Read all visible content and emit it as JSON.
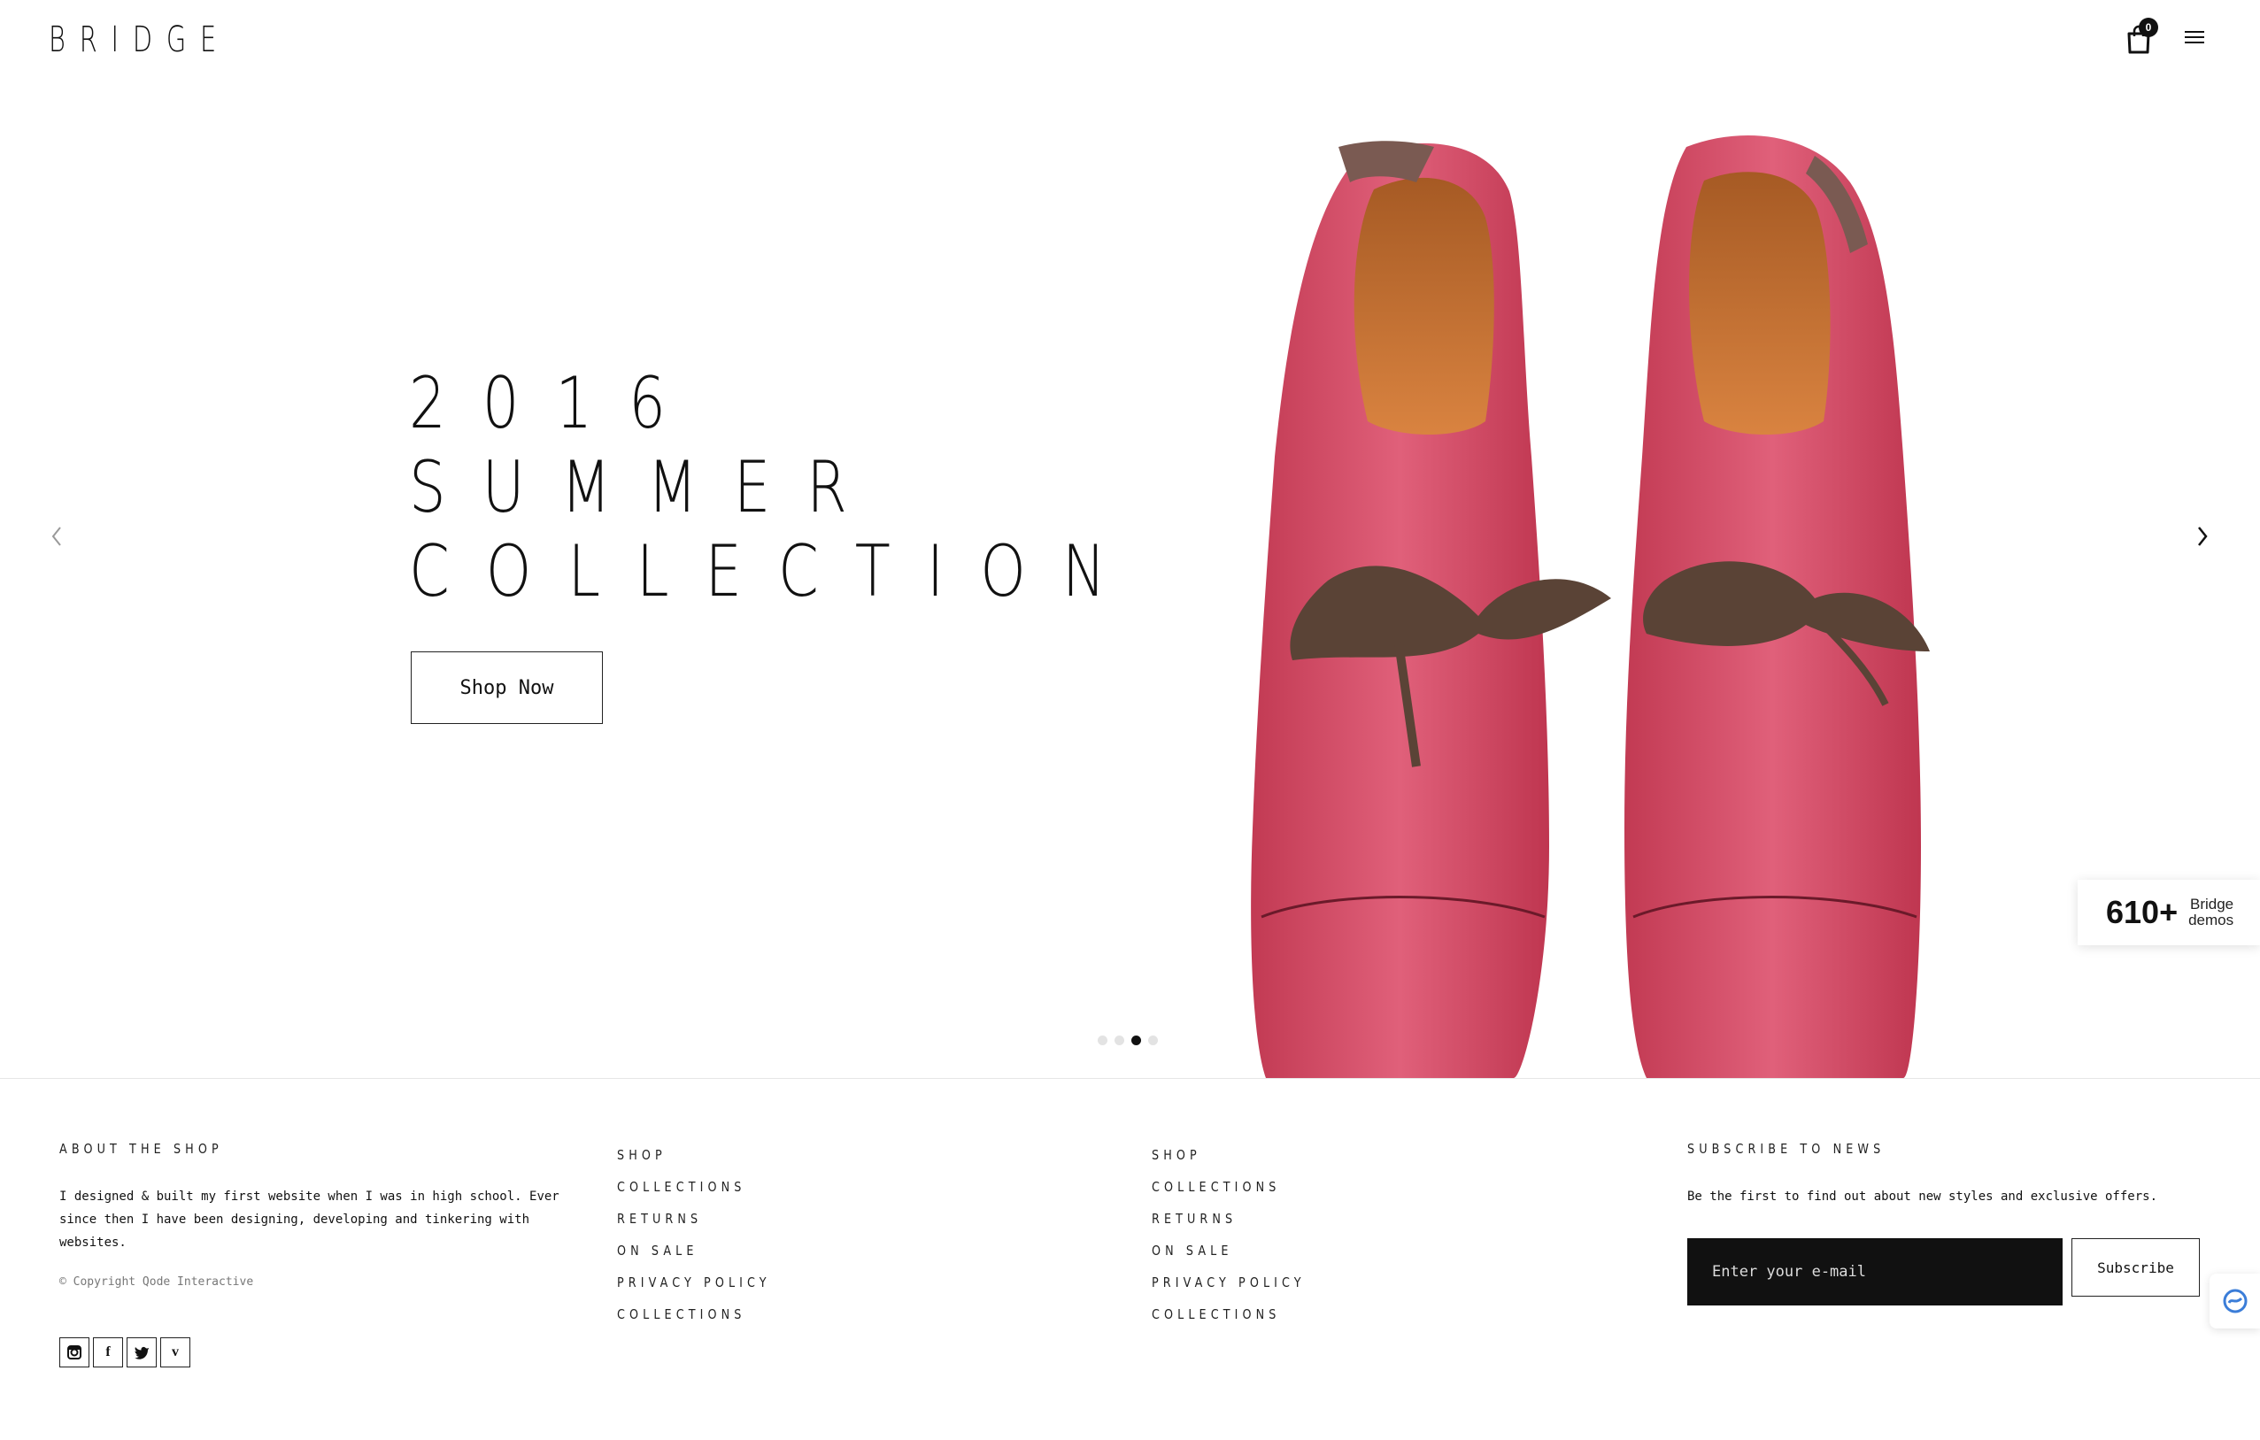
{
  "header": {
    "logo": "BRIDGE",
    "cart_count": "0",
    "cart_icon": "shopping-bag-icon",
    "menu_icon": "hamburger-menu-icon"
  },
  "hero": {
    "headline_lines": [
      "2016",
      "SUMMER",
      "COLLECTION"
    ],
    "cta_label": "Shop Now",
    "prev_icon": "chevron-left-icon",
    "next_icon": "chevron-right-icon",
    "slide_count": 4,
    "active_slide": 3,
    "image": "red-leather-shoes-photo"
  },
  "demos_badge": {
    "number": "610+",
    "line1": "Bridge",
    "line2": "demos"
  },
  "footer": {
    "about": {
      "title": "ABOUT THE SHOP",
      "text_lines": [
        "I designed & built my first website when I was in high school. Ever",
        "since then I have been designing, developing and tinkering with",
        "websites."
      ],
      "copyright": "© Copyright Qode Interactive",
      "socials": [
        "instagram-icon",
        "facebook-icon",
        "twitter-icon",
        "vimeo-icon"
      ]
    },
    "links_col1": [
      "SHOP",
      "COLLECTIONS",
      "RETURNS",
      "ON SALE",
      "PRIVACY POLICY",
      "COLLECTIONS"
    ],
    "links_col2": [
      "SHOP",
      "COLLECTIONS",
      "RETURNS",
      "ON SALE",
      "PRIVACY POLICY",
      "COLLECTIONS"
    ],
    "subscribe": {
      "title": "SUBSCRIBE TO NEWS",
      "text": "Be the first to find out about new styles and exclusive offers.",
      "placeholder": "Enter your e-mail",
      "button": "Subscribe"
    }
  },
  "colors": {
    "text": "#111111",
    "shoe": "#d2455e",
    "lace": "#5a4336",
    "inner": "#c8702e",
    "input_bg": "#111111"
  }
}
